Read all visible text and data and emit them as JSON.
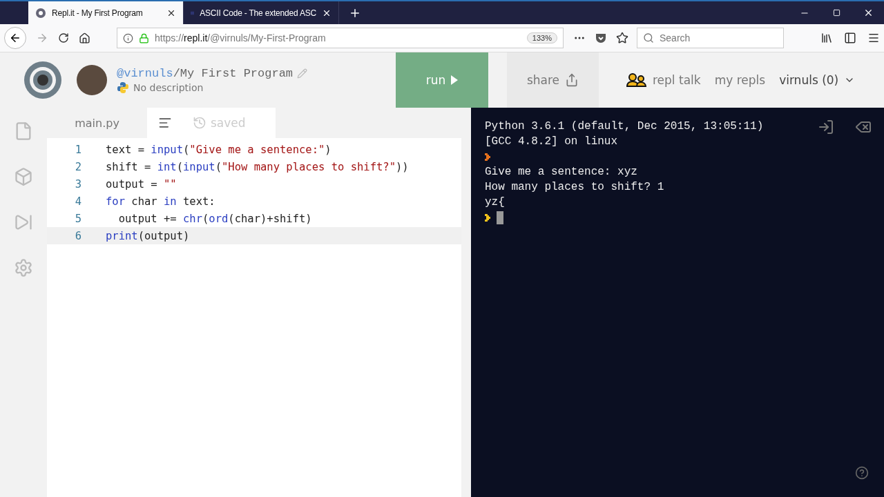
{
  "browser": {
    "tabs": [
      {
        "title": "Repl.it - My First Program",
        "selected": true
      },
      {
        "title": "ASCII Code - The extended ASC",
        "selected": false
      }
    ],
    "url": {
      "scheme": "https://",
      "host": "repl.it",
      "path": "/@virnuls/My-First-Program"
    },
    "zoom": "133%",
    "search": {
      "placeholder": "Search"
    }
  },
  "header": {
    "owner": "@virnuls",
    "separator": "/",
    "project": "My First Program",
    "description": "No description",
    "nav": [
      {
        "label": "run",
        "kind": "run"
      },
      {
        "label": "share",
        "kind": "share"
      },
      {
        "label": "repl talk",
        "kind": "talk"
      },
      {
        "label": "my repls",
        "kind": "plain"
      },
      {
        "label": "virnuls (0)",
        "kind": "user"
      }
    ]
  },
  "editor": {
    "file": "main.py",
    "status": "saved",
    "lines": [
      {
        "number": "1",
        "active": false,
        "tokens": [
          {
            "t": "text = ",
            "kind": "plain"
          },
          {
            "t": "input",
            "kind": "builtin"
          },
          {
            "t": "(",
            "kind": "plain"
          },
          {
            "t": "\"Give me a sentence:\"",
            "kind": "string"
          },
          {
            "t": ")",
            "kind": "plain"
          }
        ]
      },
      {
        "number": "2",
        "active": false,
        "tokens": [
          {
            "t": "shift = ",
            "kind": "plain"
          },
          {
            "t": "int",
            "kind": "builtin"
          },
          {
            "t": "(",
            "kind": "plain"
          },
          {
            "t": "input",
            "kind": "builtin"
          },
          {
            "t": "(",
            "kind": "plain"
          },
          {
            "t": "\"How many places to shift?\"",
            "kind": "string"
          },
          {
            "t": "))",
            "kind": "plain"
          }
        ]
      },
      {
        "number": "3",
        "active": false,
        "tokens": [
          {
            "t": "output = ",
            "kind": "plain"
          },
          {
            "t": "\"\"",
            "kind": "string"
          }
        ]
      },
      {
        "number": "4",
        "active": false,
        "tokens": [
          {
            "t": "for",
            "kind": "keyword"
          },
          {
            "t": " char ",
            "kind": "plain"
          },
          {
            "t": "in",
            "kind": "keyword"
          },
          {
            "t": " text:",
            "kind": "plain"
          }
        ]
      },
      {
        "number": "5",
        "active": false,
        "tokens": [
          {
            "t": "  output += ",
            "kind": "plain"
          },
          {
            "t": "chr",
            "kind": "builtin"
          },
          {
            "t": "(",
            "kind": "plain"
          },
          {
            "t": "ord",
            "kind": "builtin"
          },
          {
            "t": "(char)+shift)",
            "kind": "plain"
          }
        ]
      },
      {
        "number": "6",
        "active": true,
        "tokens": [
          {
            "t": "print",
            "kind": "builtin"
          },
          {
            "t": "(output)",
            "kind": "plain"
          }
        ]
      }
    ]
  },
  "console": {
    "lines": [
      {
        "kind": "text",
        "text": "Python 3.6.1 (default, Dec 2015, 13:05:11)"
      },
      {
        "kind": "text",
        "text": "[GCC 4.8.2] on linux"
      },
      {
        "kind": "prompt",
        "color": "#e8711c"
      },
      {
        "kind": "text",
        "text": "Give me a sentence: xyz"
      },
      {
        "kind": "text",
        "text": "How many places to shift? 1"
      },
      {
        "kind": "text",
        "text": "yz{"
      },
      {
        "kind": "input",
        "color": "#f2c21b"
      }
    ]
  }
}
